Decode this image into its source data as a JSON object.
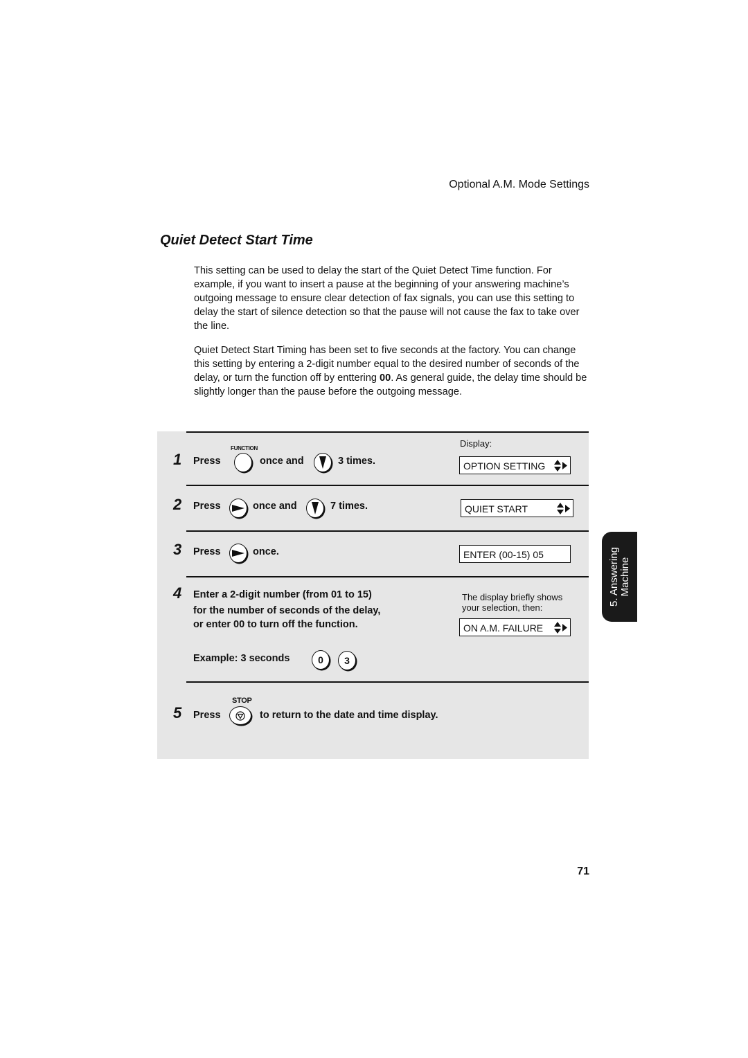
{
  "running_head": "Optional A.M. Mode Settings",
  "section_title": "Quiet Detect Start Time",
  "paragraphs": {
    "p1": "This setting can be used to delay the start of the Quiet Detect Time function. For example, if you want to insert a pause at the beginning of your answering machine’s outgoing message to ensure clear detection of fax signals, you can use this setting to delay the start of silence detection so that the pause will not cause the fax to take over the line.",
    "p2_before": "Quiet Detect Start Timing has been set to five seconds at the factory. You can change this setting by entering a 2-digit number equal to the desired number of seconds of the delay, or turn the function off by enttering ",
    "p2_bold": "00",
    "p2_after": ". As general guide, the delay time should be slightly longer than the pause before the outgoing message."
  },
  "display_label": "Display:",
  "steps": [
    {
      "number": "1",
      "press": "Press",
      "key1_label": "FUNCTION",
      "key1_icon": "function-key-icon",
      "mid": "once and",
      "key2_icon": "down-arrow-key-icon",
      "end": "3 times.",
      "display": "OPTION SETTING"
    },
    {
      "number": "2",
      "press": "Press",
      "key1_icon": "right-arrow-key-icon",
      "mid": "once and",
      "key2_icon": "down-arrow-key-icon",
      "end": "7 times.",
      "display": "QUIET START"
    },
    {
      "number": "3",
      "press": "Press",
      "key1_icon": "right-arrow-key-icon",
      "end": "once.",
      "display": "ENTER (00-15) 05"
    },
    {
      "number": "4",
      "lines": [
        "Enter a 2-digit number (from 01 to 15)",
        "for the number of seconds of the delay,",
        "or enter 00 to turn off the function."
      ],
      "example_label": "Example: 3 seconds",
      "example_keys": [
        "0",
        "3"
      ],
      "note": "The display briefly shows your selection, then:",
      "display": "ON A.M. FAILURE"
    },
    {
      "number": "5",
      "press": "Press",
      "key1_label": "STOP",
      "key1_icon": "stop-key-icon",
      "end": "to return to the date and time display."
    }
  ],
  "side_tab": {
    "line1": "5. Answering",
    "line2": "Machine"
  },
  "page_number": "71"
}
